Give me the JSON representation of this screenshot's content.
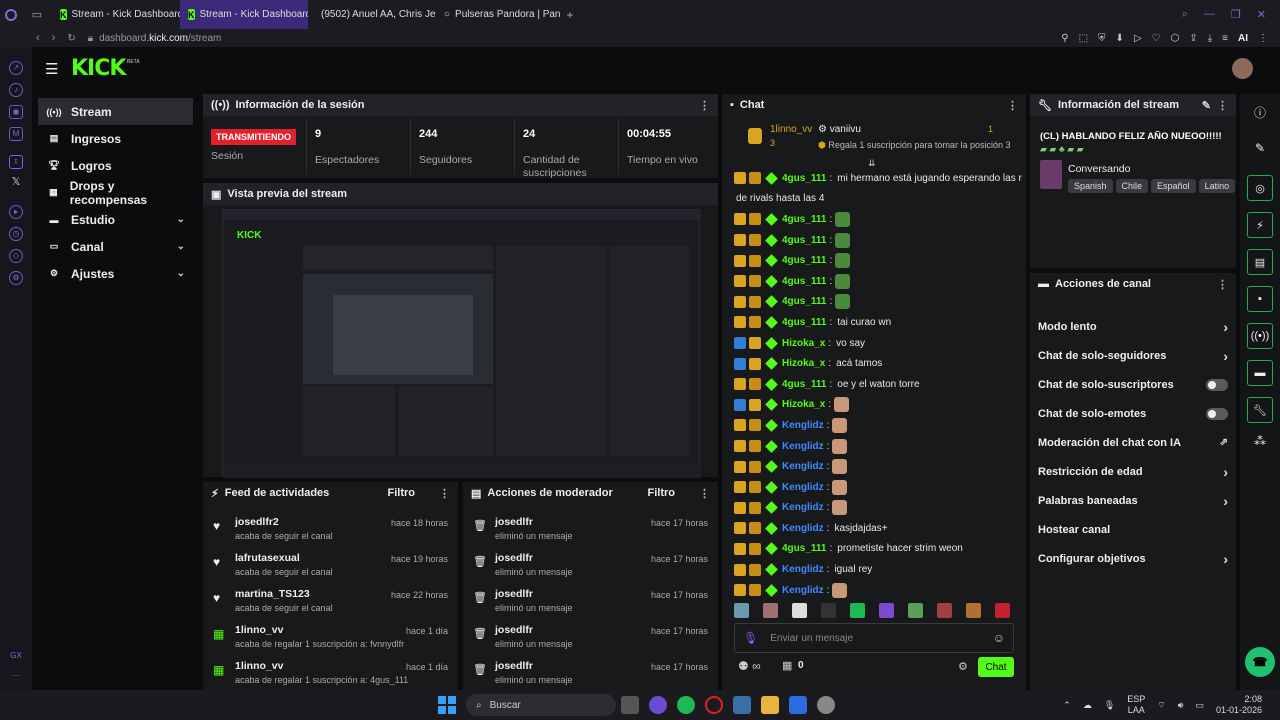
{
  "browser": {
    "tabs": [
      {
        "label": "Stream - Kick Dashboard",
        "active": false
      },
      {
        "label": "Stream - Kick Dashboard",
        "active": true
      },
      {
        "label": "(9502) Anuel AA, Chris Je...",
        "active": false
      },
      {
        "label": "Pulseras Pandora | Pandor",
        "active": false
      }
    ],
    "url_host": "dashboard.",
    "url_domain": "kick.com",
    "url_path": "/stream",
    "ai_label": "AI"
  },
  "header": {
    "logo": "KICK",
    "beta": "BETA"
  },
  "sidebar": {
    "items": [
      {
        "label": "Stream",
        "icon": "broadcast-icon",
        "expand": false
      },
      {
        "label": "Ingresos",
        "icon": "money-icon",
        "expand": false
      },
      {
        "label": "Logros",
        "icon": "trophy-icon",
        "expand": false
      },
      {
        "label": "Drops y recompensas",
        "icon": "gift-icon",
        "expand": false
      },
      {
        "label": "Estudio",
        "icon": "studio-icon",
        "expand": true
      },
      {
        "label": "Canal",
        "icon": "channel-icon",
        "expand": true
      },
      {
        "label": "Ajustes",
        "icon": "gear-icon",
        "expand": true
      }
    ]
  },
  "session": {
    "title": "Información de la sesión",
    "live_label": "TRANSMITIENDO",
    "stats": [
      {
        "value": "",
        "label": "Sesión"
      },
      {
        "value": "9",
        "label": "Espectadores"
      },
      {
        "value": "244",
        "label": "Seguidores"
      },
      {
        "value": "24",
        "label": "Cantidad de suscripciones"
      },
      {
        "value": "00:04:55",
        "label": "Tiempo en vivo"
      }
    ]
  },
  "preview": {
    "title": "Vista previa del stream"
  },
  "feed": {
    "title": "Feed de actividades",
    "filter": "Filtro",
    "rows": [
      {
        "name": "josedlfr2",
        "text": "acaba de seguir el canal",
        "time": "hace 18 horas",
        "type": "follow"
      },
      {
        "name": "lafrutasexual",
        "text": "acaba de seguir el canal",
        "time": "hace 19 horas",
        "type": "follow"
      },
      {
        "name": "martina_TS123",
        "text": "acaba de seguir el canal",
        "time": "hace 22 horas",
        "type": "follow"
      },
      {
        "name": "1linno_vv",
        "text": "acaba de regalar 1 suscripción a: fvnnydlfr",
        "time": "hace 1 día",
        "type": "gift"
      },
      {
        "name": "1linno_vv",
        "text": "acaba de regalar 1 suscripción a: 4gus_111",
        "time": "hace 1 día",
        "type": "gift"
      }
    ]
  },
  "modactions": {
    "title": "Acciones de moderador",
    "filter": "Filtro",
    "rows": [
      {
        "name": "josedlfr",
        "text": "eliminó un mensaje",
        "time": "hace 17 horas"
      },
      {
        "name": "josedlfr",
        "text": "eliminó un mensaje",
        "time": "hace 17 horas"
      },
      {
        "name": "josedlfr",
        "text": "eliminó un mensaje",
        "time": "hace 17 horas"
      },
      {
        "name": "josedlfr",
        "text": "eliminó un mensaje",
        "time": "hace 17 horas"
      },
      {
        "name": "josedlfr",
        "text": "eliminó un mensaje",
        "time": "hace 17 horas"
      }
    ]
  },
  "chat": {
    "title": "Chat",
    "pinned_user1": "1linno_vv",
    "pinned_count1": "3",
    "pinned_user2": "vaniivu",
    "pinned_count2": "1",
    "gift_prompt": "Regala 1 suscripción para tomar la posición 3",
    "input_placeholder": "Enviar un mensaje",
    "send_label": "Chat",
    "count": "0",
    "messages": [
      {
        "user": "4gus_111",
        "color": "#53fc18",
        "text": "mi hermano está jugando esperando las recs",
        "emote": false,
        "badge": "crown"
      },
      {
        "user": "",
        "color": "#e8e8e8",
        "text": "de rivals hasta las 4",
        "emote": false,
        "badge": "none"
      },
      {
        "user": "4gus_111",
        "color": "#53fc18",
        "text": "",
        "emote": true,
        "badge": "crown"
      },
      {
        "user": "4gus_111",
        "color": "#53fc18",
        "text": "",
        "emote": true,
        "badge": "crown"
      },
      {
        "user": "4gus_111",
        "color": "#53fc18",
        "text": "",
        "emote": true,
        "badge": "crown"
      },
      {
        "user": "4gus_111",
        "color": "#53fc18",
        "text": "",
        "emote": true,
        "badge": "crown"
      },
      {
        "user": "4gus_111",
        "color": "#53fc18",
        "text": "",
        "emote": true,
        "badge": "crown"
      },
      {
        "user": "4gus_111",
        "color": "#53fc18",
        "text": "tai curao wn",
        "emote": false,
        "badge": "crown"
      },
      {
        "user": "Hizoka_x",
        "color": "#53fc18",
        "text": "vo say",
        "emote": false,
        "badge": "mod"
      },
      {
        "user": "Hizoka_x",
        "color": "#53fc18",
        "text": "acá tamos",
        "emote": false,
        "badge": "mod"
      },
      {
        "user": "4gus_111",
        "color": "#53fc18",
        "text": "oe y el waton torre",
        "emote": false,
        "badge": "crown"
      },
      {
        "user": "Hizoka_x",
        "color": "#53fc18",
        "text": "",
        "emote": true,
        "badge": "mod"
      },
      {
        "user": "Kenglidz",
        "color": "#3b8cff",
        "text": "",
        "emote": true,
        "badge": "crown"
      },
      {
        "user": "Kenglidz",
        "color": "#3b8cff",
        "text": "",
        "emote": true,
        "badge": "crown"
      },
      {
        "user": "Kenglidz",
        "color": "#3b8cff",
        "text": "",
        "emote": true,
        "badge": "crown"
      },
      {
        "user": "Kenglidz",
        "color": "#3b8cff",
        "text": "",
        "emote": true,
        "badge": "crown"
      },
      {
        "user": "Kenglidz",
        "color": "#3b8cff",
        "text": "",
        "emote": true,
        "badge": "crown"
      },
      {
        "user": "Kenglidz",
        "color": "#3b8cff",
        "text": "kasjdajdas+",
        "emote": false,
        "badge": "crown"
      },
      {
        "user": "4gus_111",
        "color": "#53fc18",
        "text": "prometiste hacer strim weon",
        "emote": false,
        "badge": "crown"
      },
      {
        "user": "Kenglidz",
        "color": "#3b8cff",
        "text": "igual rey",
        "emote": false,
        "badge": "crown"
      },
      {
        "user": "Kenglidz",
        "color": "#3b8cff",
        "text": "",
        "emote": true,
        "badge": "crown"
      }
    ]
  },
  "streaminfo": {
    "title": "Información del stream",
    "stream_title": "(CL) HABLANDO FELIZ AÑO NUEOO!!!!!",
    "category": "Conversando",
    "tags": [
      "Spanish",
      "Chile",
      "Español",
      "Latino"
    ]
  },
  "channelactions": {
    "title": "Acciones de canal",
    "items": [
      {
        "label": "Modo lento",
        "control": "chevron"
      },
      {
        "label": "Chat de solo-seguidores",
        "control": "chevron"
      },
      {
        "label": "Chat de solo-suscriptores",
        "control": "toggle"
      },
      {
        "label": "Chat de solo-emotes",
        "control": "toggle"
      },
      {
        "label": "Moderación del chat con IA",
        "control": "external"
      },
      {
        "label": "Restricción de edad",
        "control": "chevron"
      },
      {
        "label": "Palabras baneadas",
        "control": "chevron"
      },
      {
        "label": "Hostear canal",
        "control": "none"
      },
      {
        "label": "Configurar objetivos",
        "control": "chevron"
      }
    ]
  },
  "taskbar": {
    "search_placeholder": "Buscar",
    "lang1": "ESP",
    "lang2": "LAA",
    "time": "2:08",
    "date": "01-01-2026"
  },
  "dock_label": "GX",
  "colors": {
    "accent": "#53fc18",
    "live": "#e0212c",
    "bg": "#0b0c0d",
    "panel": "#18191b"
  }
}
